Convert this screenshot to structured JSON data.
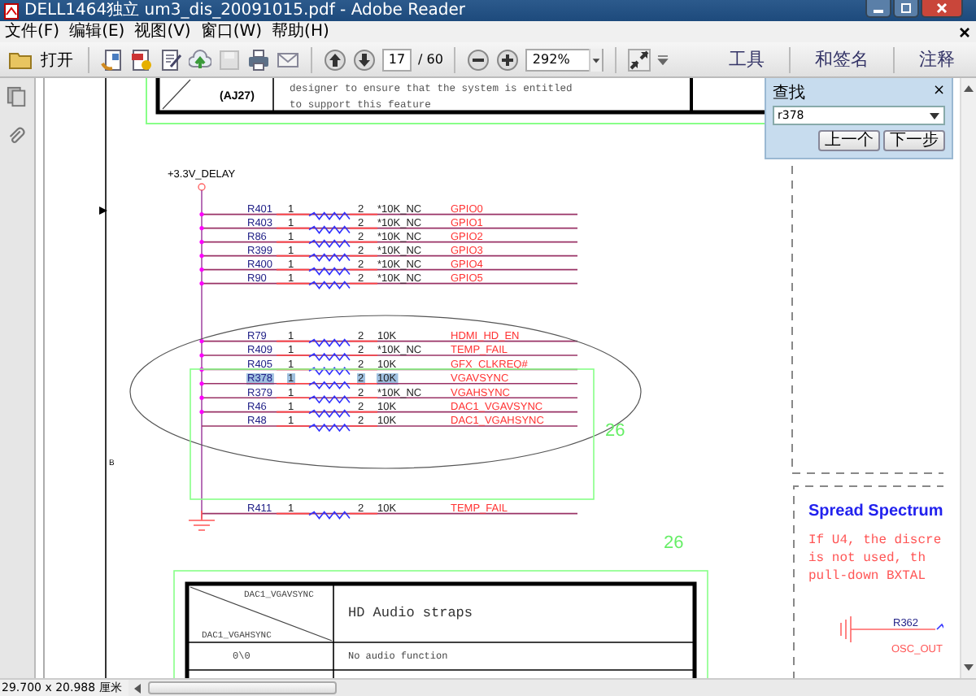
{
  "window": {
    "title": "DELL1464独立  um3_dis_20091015.pdf - Adobe Reader"
  },
  "menu": [
    "文件(F)",
    "编辑(E)",
    "视图(V)",
    "窗口(W)",
    "帮助(H)"
  ],
  "toolbar": {
    "open": "打开",
    "page": "17",
    "page_total": "/ 60",
    "zoom": "292%",
    "panels": [
      "工具",
      "和签名",
      "注释"
    ]
  },
  "find_panel": {
    "title": "查找",
    "close": "×",
    "query": "r378",
    "buttons": [
      "上一个",
      "下一步"
    ]
  },
  "schematic": {
    "top_box": {
      "ball": "(AJ27)",
      "lines": [
        "designer to ensure  that the system is entitled",
        "to support this feature"
      ]
    },
    "zone_label": "B",
    "rail": "+3.3V_DELAY",
    "resistor_groups": [
      {
        "rows": [
          {
            "ref": "R401",
            "pin1": "1",
            "pin2": "2",
            "value": "*10K_NC",
            "net": "GPIO0",
            "junction": true,
            "highlighted": false
          },
          {
            "ref": "R403",
            "pin1": "1",
            "pin2": "2",
            "value": "*10K_NC",
            "net": "GPIO1",
            "junction": true,
            "highlighted": false
          },
          {
            "ref": "R86",
            "pin1": "1",
            "pin2": "2",
            "value": "*10K_NC",
            "net": "GPIO2",
            "junction": true,
            "highlighted": false
          },
          {
            "ref": "R399",
            "pin1": "1",
            "pin2": "2",
            "value": "*10K_NC",
            "net": "GPIO3",
            "junction": true,
            "highlighted": false
          },
          {
            "ref": "R400",
            "pin1": "1",
            "pin2": "2",
            "value": "*10K_NC",
            "net": "GPIO4",
            "junction": true,
            "highlighted": false
          },
          {
            "ref": "R90",
            "pin1": "1",
            "pin2": "2",
            "value": "*10K_NC",
            "net": "GPIO5",
            "junction": true,
            "highlighted": false
          }
        ]
      },
      {
        "rows": [
          {
            "ref": "R79",
            "pin1": "1",
            "pin2": "2",
            "value": "10K",
            "net": "HDMI_HD_EN",
            "junction": true,
            "highlighted": false
          },
          {
            "ref": "R409",
            "pin1": "1",
            "pin2": "2",
            "value": "*10K_NC",
            "net": "TEMP_FAIL",
            "junction": true,
            "highlighted": false
          },
          {
            "ref": "R405",
            "pin1": "1",
            "pin2": "2",
            "value": "10K",
            "net": "GFX_CLKREQ#",
            "junction": true,
            "highlighted": false
          },
          {
            "ref": "R378",
            "pin1": "1",
            "pin2": "2",
            "value": "10K",
            "net": "VGAVSYNC",
            "junction": true,
            "highlighted": true
          },
          {
            "ref": "R379",
            "pin1": "1",
            "pin2": "2",
            "value": "*10K_NC",
            "net": "VGAHSYNC",
            "junction": true,
            "highlighted": false
          },
          {
            "ref": "R46",
            "pin1": "1",
            "pin2": "2",
            "value": "10K",
            "net": "DAC1_VGAVSYNC",
            "junction": true,
            "highlighted": false
          },
          {
            "ref": "R48",
            "pin1": "1",
            "pin2": "2",
            "value": "10K",
            "net": "DAC1_VGAHSYNC",
            "junction": false,
            "highlighted": false
          }
        ]
      },
      {
        "rows": [
          {
            "ref": "R411",
            "pin1": "1",
            "pin2": "2",
            "value": "10K",
            "net": "TEMP_FAIL",
            "junction": false,
            "highlighted": false
          }
        ]
      }
    ],
    "page_marks": [
      "26",
      "26"
    ],
    "strap_table": {
      "col_top": "DAC1_VGAVSYNC",
      "col_left": "DAC1_VGAHSYNC",
      "title": "HD Audio straps",
      "rows": [
        {
          "code": "0\\0",
          "description": "No audio function"
        }
      ]
    },
    "note": {
      "title": "Spread Spectrum",
      "lines": [
        "If U4, the discre",
        "is not used, th",
        "pull-down BXTAL"
      ],
      "ref": "R362",
      "net": "OSC_OUT"
    }
  },
  "status_bar": {
    "size": "29.700 x 20.988 厘米"
  }
}
